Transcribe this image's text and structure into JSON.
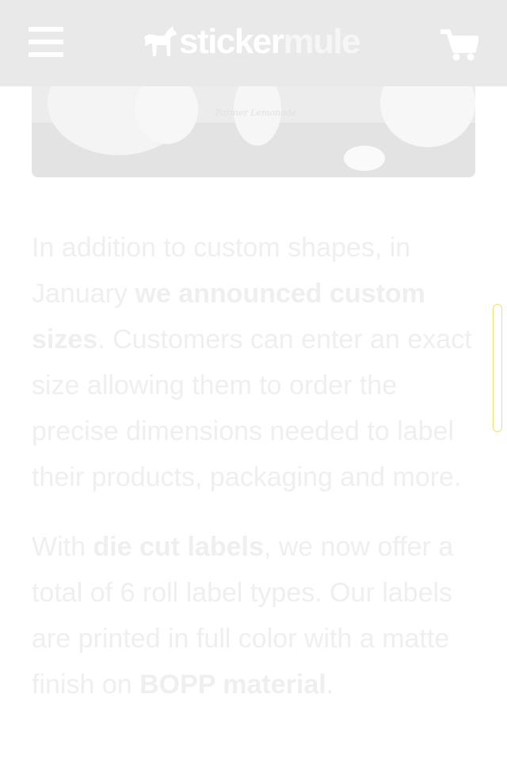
{
  "header": {
    "logo": {
      "part1": "sticker",
      "part2": "mule"
    },
    "menu_icon": "hamburger-menu-icon",
    "cart_icon": "shopping-cart-icon"
  },
  "hero": {
    "label_text": "Farmer Lemonade"
  },
  "article": {
    "p1": {
      "t1": "In addition to custom shapes, in January ",
      "link": "we announced custom sizes",
      "t2": ". Customers can enter an exact size allowing them to order the precise dimensions needed to label their products, packaging and more."
    },
    "p2": {
      "t1": "With ",
      "link1": "die cut labels",
      "t2": ", we now offer a total of 6 roll label types. Our labels are printed in full color with a matte finish on ",
      "link2": "BOPP material",
      "t3": "."
    }
  },
  "colors": {
    "header_bg": "#e9e9e9",
    "text": "#efefef",
    "scroll_outline": "#f5e06a"
  }
}
